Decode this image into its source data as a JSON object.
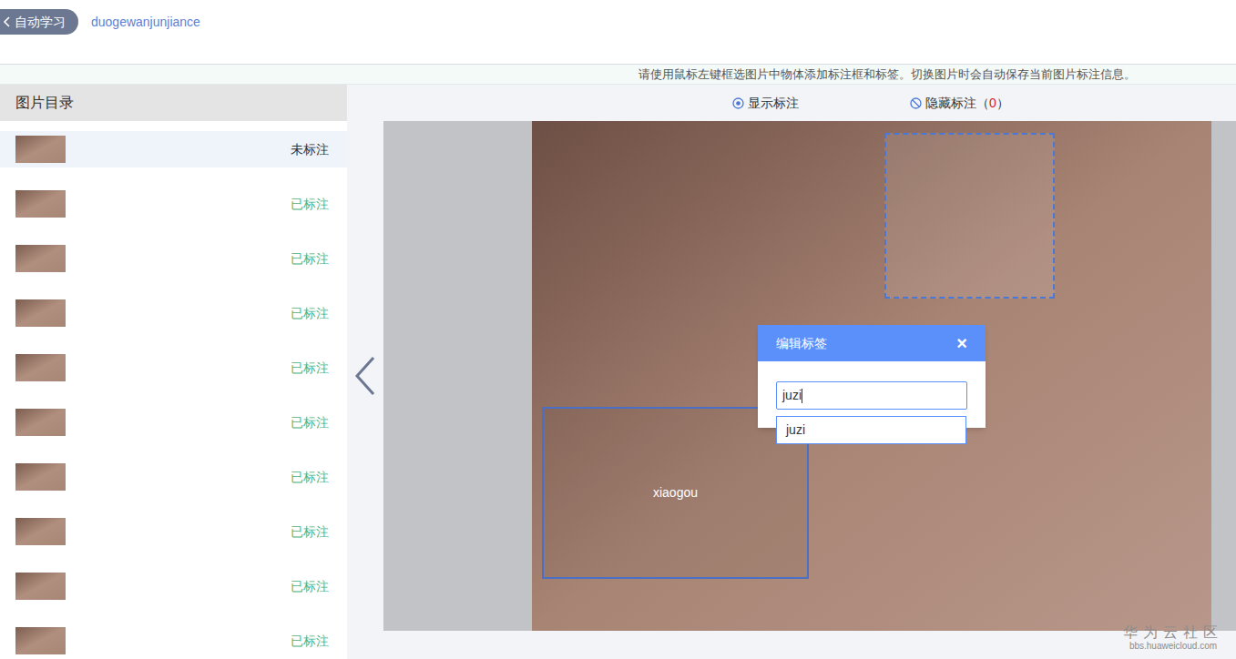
{
  "header": {
    "back_button": "自动学习",
    "project_name": "duogewanjunjiance"
  },
  "hint": "请使用鼠标左键框选图片中物体添加标注框和标签。切换图片时会自动保存当前图片标注信息。",
  "sidebar": {
    "title": "图片目录",
    "items": [
      {
        "status": "未标注",
        "annotated": false,
        "selected": true
      },
      {
        "status": "已标注",
        "annotated": true,
        "selected": false
      },
      {
        "status": "已标注",
        "annotated": true,
        "selected": false
      },
      {
        "status": "已标注",
        "annotated": true,
        "selected": false
      },
      {
        "status": "已标注",
        "annotated": true,
        "selected": false
      },
      {
        "status": "已标注",
        "annotated": true,
        "selected": false
      },
      {
        "status": "已标注",
        "annotated": true,
        "selected": false
      },
      {
        "status": "已标注",
        "annotated": true,
        "selected": false
      },
      {
        "status": "已标注",
        "annotated": true,
        "selected": false
      },
      {
        "status": "已标注",
        "annotated": true,
        "selected": false
      }
    ]
  },
  "toolbar": {
    "show_label": "显示标注",
    "hide_label": "隐藏标注",
    "hide_count_prefix": "（",
    "hide_count": "0",
    "hide_count_suffix": "）"
  },
  "annotations": [
    {
      "label": "",
      "selected": true
    },
    {
      "label": "xiaogou",
      "selected": false
    }
  ],
  "dialog": {
    "title": "编辑标签",
    "close": "×",
    "input_value": "juzi",
    "suggestions": [
      "juzi"
    ]
  },
  "watermark": {
    "brand": "华为云社区",
    "url": "bbs.huaweicloud.com"
  }
}
